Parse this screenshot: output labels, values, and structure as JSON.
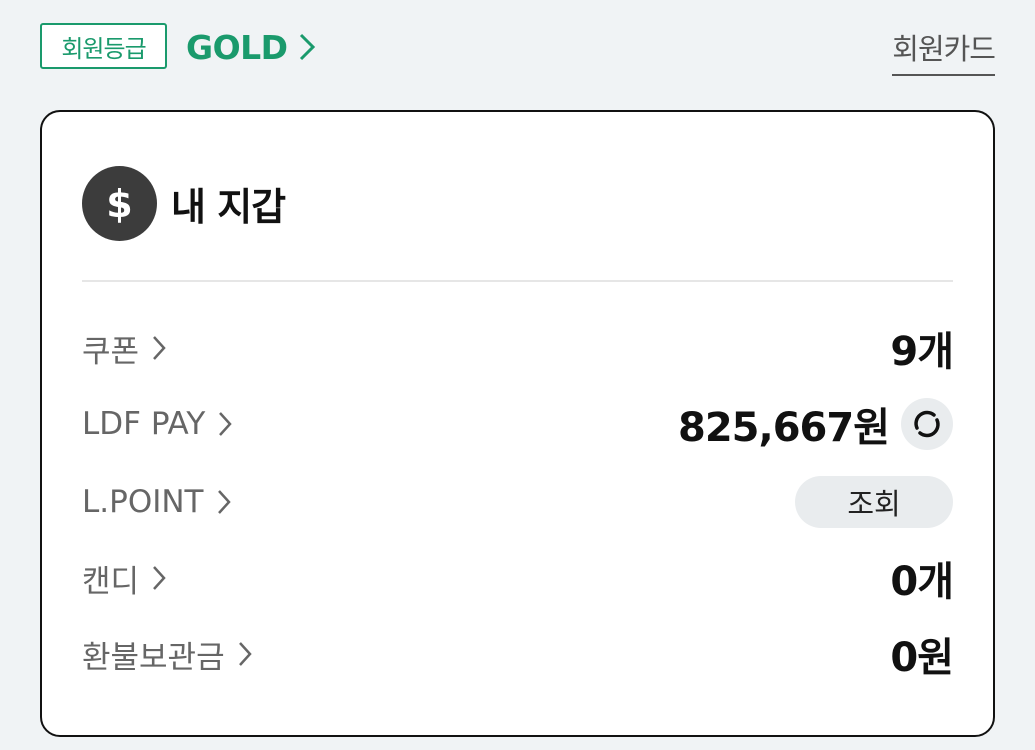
{
  "header": {
    "grade_badge_label": "회원등급",
    "grade_name": "GOLD",
    "member_card_link": "회원카드"
  },
  "wallet": {
    "icon_symbol": "$",
    "title": "내 지갑",
    "rows": [
      {
        "label": "쿠폰",
        "value": "9개"
      },
      {
        "label": "LDF PAY",
        "value": "825,667원"
      },
      {
        "label": "L.POINT",
        "button": "조회"
      },
      {
        "label": "캔디",
        "value": "0개"
      },
      {
        "label": "환불보관금",
        "value": "0원"
      }
    ]
  },
  "colors": {
    "accent": "#1a9a6c",
    "background": "#f0f3f5",
    "coin": "#3c3c3c"
  },
  "icons": {
    "chevron": "chevron-right-icon",
    "refresh": "refresh-icon",
    "coin": "dollar-coin-icon"
  }
}
